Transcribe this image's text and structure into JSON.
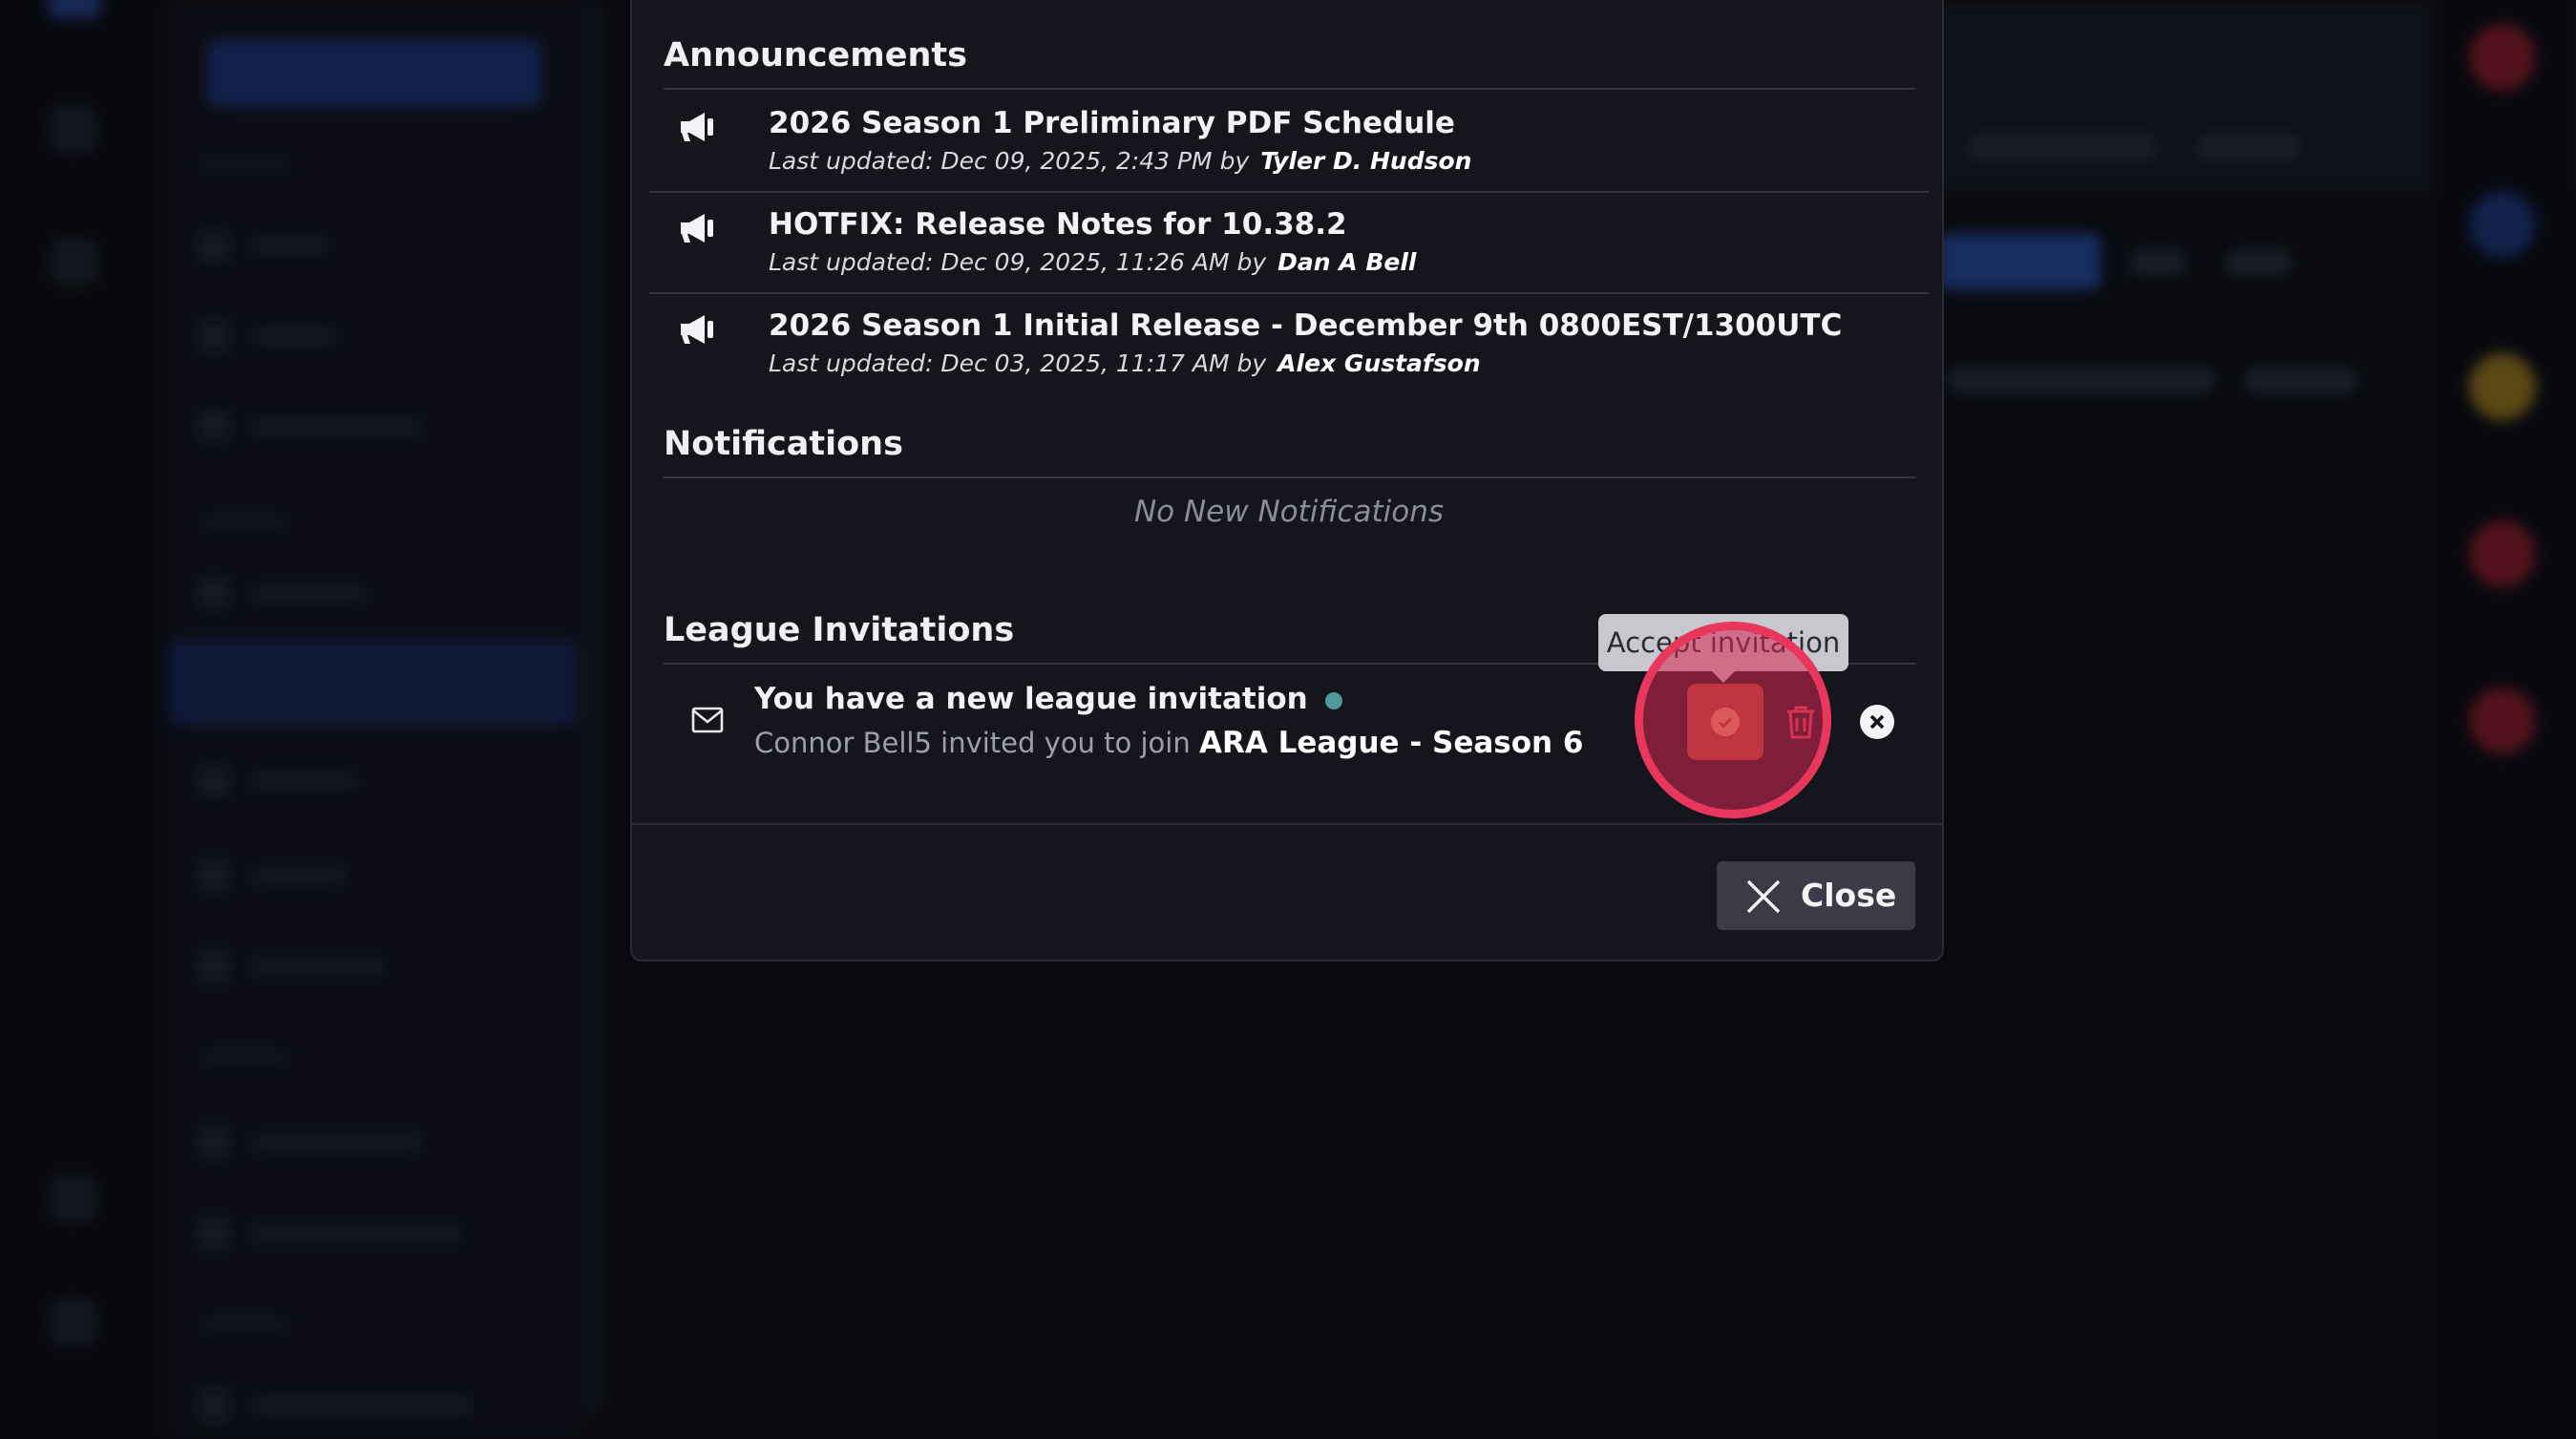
{
  "modal": {
    "announcements": {
      "title": "Announcements",
      "items": [
        {
          "title": "2026 Season 1 Preliminary PDF Schedule",
          "meta": "Last updated: Dec 09, 2025, 2:43 PM by",
          "author": "Tyler D. Hudson"
        },
        {
          "title": "HOTFIX: Release Notes for 10.38.2",
          "meta": "Last updated: Dec 09, 2025, 11:26 AM by",
          "author": "Dan A Bell"
        },
        {
          "title": "2026 Season 1 Initial Release - December 9th 0800EST/1300UTC",
          "meta": "Last updated: Dec 03, 2025, 11:17 AM by",
          "author": "Alex Gustafson"
        }
      ]
    },
    "notifications": {
      "title": "Notifications",
      "empty_text": "No New Notifications"
    },
    "invitations": {
      "title": "League Invitations",
      "item": {
        "title": "You have a new league invitation",
        "subtitle_prefix": "Connor Bell5 invited you to join",
        "league_name": "ARA League - Season 6"
      },
      "tooltip": "Accept invitation"
    },
    "close_label": "Close"
  },
  "icons": {
    "announcement": "megaphone-icon",
    "invitation": "envelope-icon",
    "accept": "check-circle-icon",
    "delete": "trash-icon",
    "dismiss": "close-circle-icon",
    "close": "close-icon"
  },
  "colors": {
    "modal_bg": "#15161d",
    "accept_button": "#a6482f",
    "highlight": "#e8365c",
    "unread_dot": "#4f9a9a",
    "trash": "#e0405a"
  }
}
